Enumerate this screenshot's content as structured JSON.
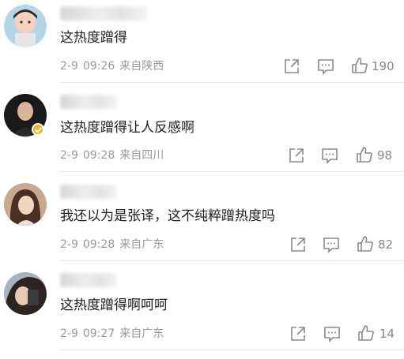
{
  "comments": [
    {
      "text": "这热度蹭得",
      "date": "2-9",
      "time": "09:26",
      "location": "来自陕西",
      "likes": "190",
      "avatar_icon": "child-avatar",
      "verified": false
    },
    {
      "text": "这热度蹭得让人反感啊",
      "date": "2-9",
      "time": "09:28",
      "location": "来自四川",
      "likes": "98",
      "avatar_icon": "man-avatar",
      "verified": true
    },
    {
      "text": "我还以为是张译，这不纯粹蹭热度吗",
      "date": "2-9",
      "time": "09:28",
      "location": "来自广东",
      "likes": "82",
      "avatar_icon": "woman-avatar",
      "verified": false
    },
    {
      "text": "这热度蹭得啊呵呵",
      "date": "2-9",
      "time": "09:27",
      "location": "来自广东",
      "likes": "14",
      "avatar_icon": "woman-selfie-avatar",
      "verified": false
    }
  ],
  "icons": {
    "share": "share-icon",
    "comment": "comment-icon",
    "like": "thumbs-up-icon"
  },
  "colors": {
    "text": "#222222",
    "meta": "#999999",
    "verified_badge": "#f5b321"
  }
}
